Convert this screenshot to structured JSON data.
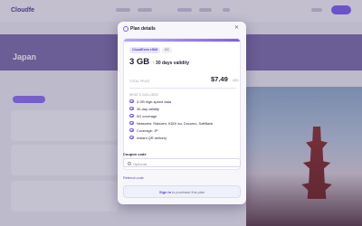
{
  "background": {
    "logo": "Cloudfe",
    "page_title": "Japan"
  },
  "modal": {
    "title": "Plan details",
    "close_icon": "close-icon",
    "plan": {
      "brand_chip": "CloudEsim eSIM",
      "tech_chip": "5G",
      "data_amount": "3 GB",
      "validity": "· 30 days validity",
      "price_label": "TOTAL PRICE",
      "price": "$7.49",
      "currency": "USD",
      "included_label": "WHAT'S INCLUDED",
      "features": [
        "3 GB high-speed data",
        "30-day validity",
        "5G coverage",
        "Networks: Rakuten, KDDI au, Docomo, SoftBank",
        "Coverage: JP",
        "Instant QR delivery"
      ]
    },
    "coupon": {
      "label": "Coupon code",
      "placeholder": "Optional"
    },
    "referral_link": "Referral code",
    "signin": {
      "link": "Sign in",
      "rest": " to purchase this plan"
    }
  },
  "colors": {
    "accent": "#7b5cf0",
    "overlay": "#463c64"
  }
}
